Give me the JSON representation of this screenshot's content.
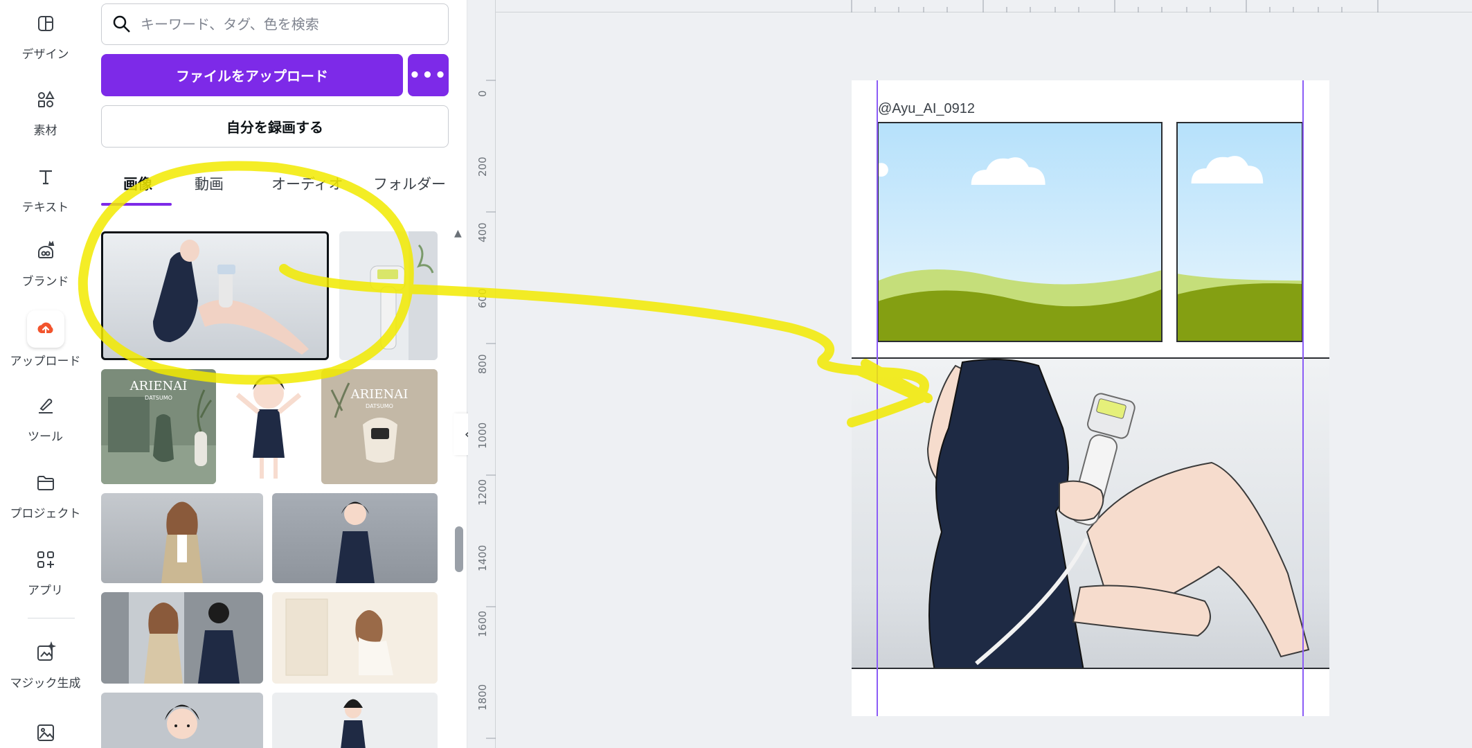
{
  "rail": {
    "items": [
      {
        "label": "デザイン",
        "icon": "design-icon"
      },
      {
        "label": "素材",
        "icon": "elements-icon"
      },
      {
        "label": "テキスト",
        "icon": "text-icon"
      },
      {
        "label": "ブランド",
        "icon": "brand-icon"
      },
      {
        "label": "アップロード",
        "icon": "upload-icon"
      },
      {
        "label": "ツール",
        "icon": "tools-icon"
      },
      {
        "label": "プロジェクト",
        "icon": "projects-icon"
      },
      {
        "label": "アプリ",
        "icon": "apps-icon"
      },
      {
        "label": "マジック生成",
        "icon": "magic-generate-icon"
      }
    ],
    "active_index": 4
  },
  "panel": {
    "search_placeholder": "キーワード、タグ、色を検索",
    "upload_button": "ファイルをアップロード",
    "more_button": "•••",
    "record_button": "自分を録画する",
    "tabs": [
      "画像",
      "動画",
      "オーディオ",
      "フォルダー"
    ],
    "active_tab": 0,
    "collapse_icon": "‹"
  },
  "ruler": {
    "vertical_labels": [
      "0",
      "200",
      "400",
      "600",
      "800",
      "1000",
      "1200",
      "1400",
      "1600",
      "1800"
    ]
  },
  "canvas": {
    "credit": "@Ayu_AI_0912"
  },
  "colors": {
    "accent": "#7d2ae8",
    "guide": "#8b5cf6",
    "annotation": "#f2ea00"
  }
}
